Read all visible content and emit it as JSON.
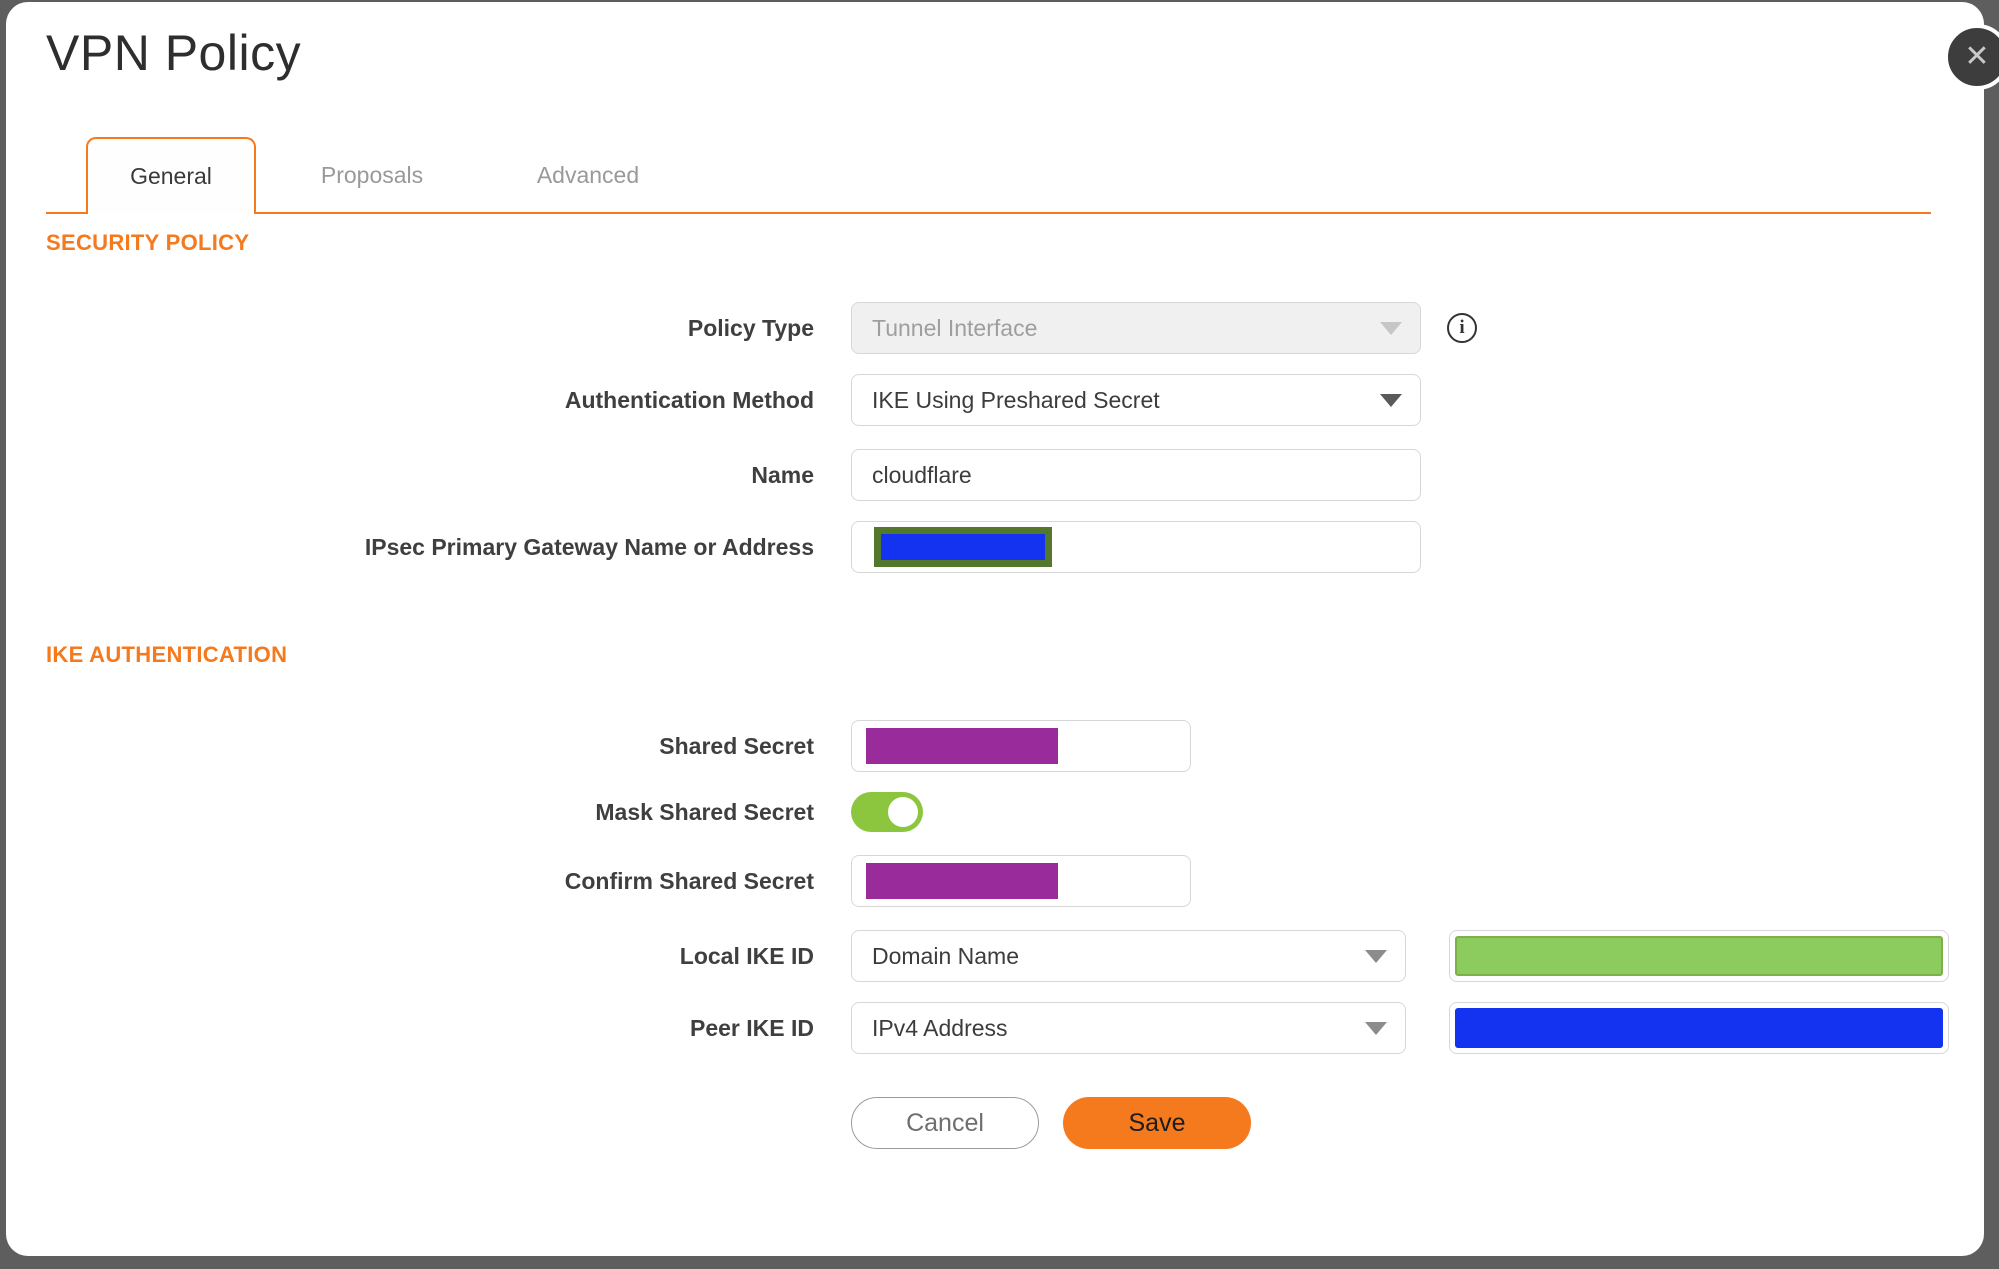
{
  "modal": {
    "title": "VPN Policy",
    "close_glyph": "✕",
    "info_glyph": "i"
  },
  "tabs": [
    {
      "label": "General",
      "active": true
    },
    {
      "label": "Proposals",
      "active": false
    },
    {
      "label": "Advanced",
      "active": false
    }
  ],
  "sections": {
    "security_policy": {
      "heading": "SECURITY POLICY",
      "policy_type": {
        "label": "Policy Type",
        "value": "Tunnel Interface",
        "disabled": true
      },
      "authentication_method": {
        "label": "Authentication Method",
        "value": "IKE Using Preshared Secret"
      },
      "name": {
        "label": "Name",
        "value": "cloudflare"
      },
      "ipsec_primary_gateway": {
        "label": "IPsec Primary Gateway Name or Address",
        "value_redacted": true
      }
    },
    "ike_authentication": {
      "heading": "IKE AUTHENTICATION",
      "shared_secret": {
        "label": "Shared Secret",
        "value_redacted": true
      },
      "mask_shared_secret": {
        "label": "Mask Shared Secret",
        "enabled": true
      },
      "confirm_shared_secret": {
        "label": "Confirm Shared Secret",
        "value_redacted": true
      },
      "local_ike_id": {
        "label": "Local IKE ID",
        "type_value": "Domain Name",
        "value_redacted": true
      },
      "peer_ike_id": {
        "label": "Peer IKE ID",
        "type_value": "IPv4 Address",
        "value_redacted": true
      }
    }
  },
  "buttons": {
    "cancel": "Cancel",
    "save": "Save"
  },
  "colors": {
    "accent_orange": "#f5791d",
    "toggle_green": "#8cc63f",
    "redaction_purple": "#9a2b9b",
    "redaction_blue": "#1433f0",
    "redaction_green": "#8ccb5e",
    "redaction_olive_border": "#53772c"
  }
}
